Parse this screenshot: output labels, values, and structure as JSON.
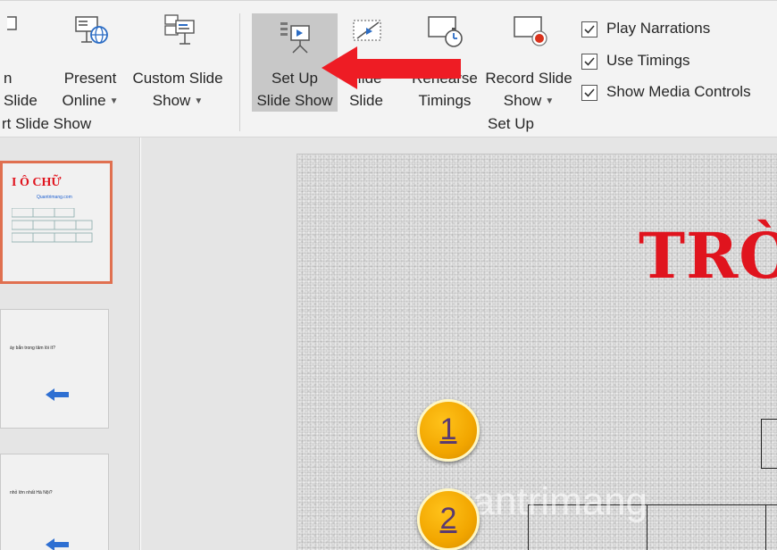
{
  "ribbon": {
    "buttons": [
      {
        "id": "from-current",
        "line1": "n",
        "line2": "Slide"
      },
      {
        "id": "present-online",
        "line1": "Present",
        "line2": "Online"
      },
      {
        "id": "custom-slide-show",
        "line1": "Custom Slide",
        "line2": "Show"
      },
      {
        "id": "set-up-slide-show",
        "line1": "Set Up",
        "line2": "Slide Show"
      },
      {
        "id": "hide-slide",
        "line1": "Hide",
        "line2": "Slide"
      },
      {
        "id": "rehearse-timings",
        "line1": "Rehearse",
        "line2": "Timings"
      },
      {
        "id": "record-slide-show",
        "line1": "Record Slide",
        "line2": "Show"
      }
    ],
    "groups": {
      "start_slide_show": "rt Slide Show",
      "set_up": "Set Up"
    },
    "checkboxes": [
      {
        "label": "Play Narrations",
        "checked": true
      },
      {
        "label": "Use Timings",
        "checked": true
      },
      {
        "label": "Show Media Controls",
        "checked": true
      }
    ]
  },
  "thumbnails": {
    "slide1_title": "I Ô CHỮ",
    "slide1_sub": "Quantrimang.com",
    "slide2_text": "ày bắn trong tâm lòi ít?",
    "slide3_text": "nhỏ lớn nhất Hà Nội?"
  },
  "slide": {
    "title": "TRÒ",
    "circle1": "1",
    "circle2": "2",
    "watermark": "uantrimang"
  },
  "colors": {
    "accent_red": "#e0141e",
    "selection": "#e07050",
    "gold": "#f2a600"
  },
  "icons": {
    "present_online": "globe-presentation-icon",
    "custom_slide_show": "custom-slides-icon",
    "set_up_slide_show": "projector-setup-icon",
    "hide_slide": "hide-slide-icon",
    "rehearse_timings": "stopwatch-icon",
    "record_slide_show": "record-icon"
  }
}
